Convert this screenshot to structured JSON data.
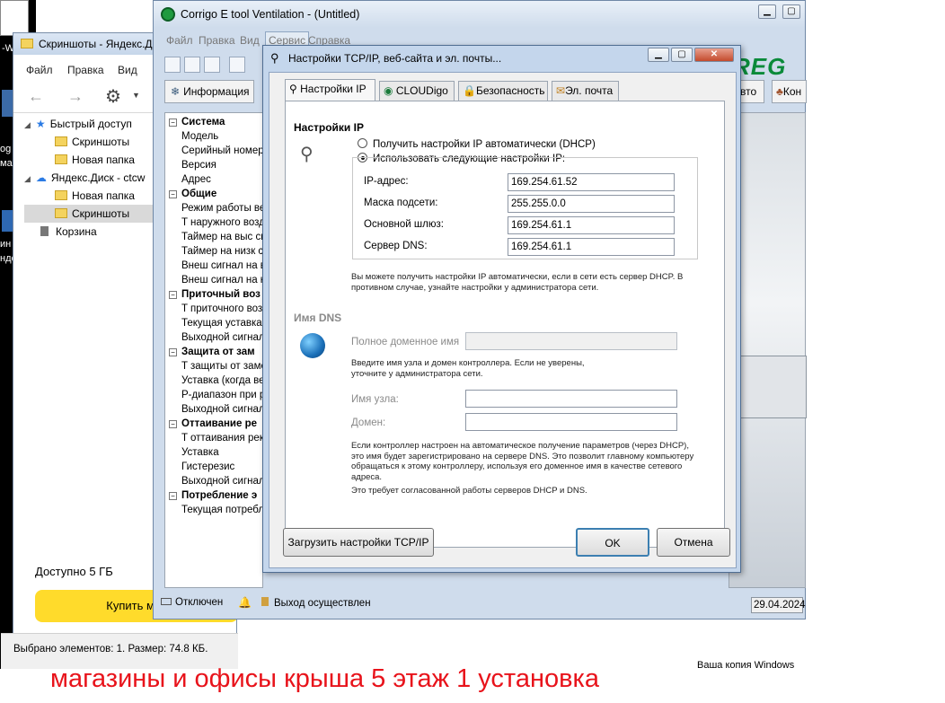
{
  "desktop": {
    "frag_top": "-W",
    "frag_1": "og",
    "frag_2": "ма",
    "frag_3": "ин",
    "frag_4": "нде"
  },
  "explorer": {
    "title": "Скриншоты - Яндекс.Ди",
    "menu": [
      "Файл",
      "Правка",
      "Вид"
    ],
    "tree": [
      {
        "label": "Быстрый доступ",
        "icon": "star-icon"
      },
      {
        "label": "Скриншоты",
        "icon": "folder-icon"
      },
      {
        "label": "Новая папка",
        "icon": "folder-icon"
      },
      {
        "label": "Яндекс.Диск - ctcw",
        "icon": "cloud-icon"
      },
      {
        "label": "Новая папка",
        "icon": "folder-icon"
      },
      {
        "label": "Скриншоты",
        "icon": "folder-icon"
      },
      {
        "label": "Корзина",
        "icon": "trash-icon"
      }
    ],
    "available": "Доступно 5 ГБ",
    "buy_button": "Купить мес",
    "status": "Выбрано элементов: 1. Размер: 74.8 КБ."
  },
  "corrigo": {
    "title": "Corrigo E tool Ventilation - (Untitled)",
    "menu": [
      "Файл",
      "Правка",
      "Вид",
      "Сервис",
      "Справка"
    ],
    "info_tab": "Информация",
    "right_tab_1": "вто",
    "right_tab_2": "Кон",
    "logo": "REG",
    "tree": [
      {
        "label": "Система",
        "head": true
      },
      {
        "label": "Модель"
      },
      {
        "label": "Серийный номер"
      },
      {
        "label": "Версия"
      },
      {
        "label": "Адрес"
      },
      {
        "label": "Общие",
        "head": true
      },
      {
        "label": "Режим работы ве"
      },
      {
        "label": "T наружного возд"
      },
      {
        "label": "Таймер на выс сн"
      },
      {
        "label": "Таймер на низк с"
      },
      {
        "label": "Внеш сигнал на в"
      },
      {
        "label": "Внеш сигнал на н"
      },
      {
        "label": "Приточный воз",
        "head": true
      },
      {
        "label": "T приточного воз"
      },
      {
        "label": "Текущая уставка"
      },
      {
        "label": "Выходной сигнал"
      },
      {
        "label": "Защита от зам",
        "head": true
      },
      {
        "label": "T защиты от замо"
      },
      {
        "label": "Уставка (когда ве"
      },
      {
        "label": "P-диапазон при р"
      },
      {
        "label": "Выходной сигнал"
      },
      {
        "label": "Оттаивание ре",
        "head": true
      },
      {
        "label": "T оттаивания рек"
      },
      {
        "label": "Уставка"
      },
      {
        "label": "Гистерезис"
      },
      {
        "label": "Выходной сигнал"
      },
      {
        "label": "Потребление э",
        "head": true
      },
      {
        "label": "Текущая потребл"
      }
    ],
    "status": {
      "disconnected": "Отключен",
      "logout": "Выход осуществлен",
      "date": "29.04.2024"
    },
    "windows_note": "Ваша копия Windows"
  },
  "dialog": {
    "title": "Настройки TCP/IP, веб-сайта и эл. почты...",
    "tabs": [
      "Настройки IP",
      "CLOUDigo",
      "Безопасность",
      "Эл. почта"
    ],
    "ip_section_title": "Настройки IP",
    "radio_auto": "Получить настройки IP автоматически (DHCP)",
    "radio_manual": "Использовать следующие настройки IP:",
    "fields": [
      {
        "label": "IP-адрес:",
        "value": "169.254.61.52"
      },
      {
        "label": "Маска подсети:",
        "value": "255.255.0.0"
      },
      {
        "label": "Основной шлюз:",
        "value": "169.254.61.1"
      },
      {
        "label": "Сервер DNS:",
        "value": "169.254.61.1"
      }
    ],
    "ip_note": "Вы можете получить настройки IP автоматически, если в сети есть сервер DHCP. В противном случае, узнайте настройки у администратора сети.",
    "dns_section_title": "Имя DNS",
    "fqdn_label": "Полное доменное имя",
    "fqdn_value": "",
    "dns_note": "Введите имя узла и домен контроллера. Если не уверены, уточните у администратора сети.",
    "host_label": "Имя узла:",
    "host_value": "",
    "domain_label": "Домен:",
    "domain_value": "",
    "dhcp_note": "Если контроллер настроен на автоматическое получение параметров (через DHCP), это имя будет зарегистрировано на сервере DNS. Это позволит главному компьютеру обращаться к этому контроллеру, используя его доменное имя в качестве сетевого адреса.",
    "dhcp_note2": "Это требует согласованной работы серверов DHCP и DNS.",
    "load_button": "Загрузить настройки TCP/IP",
    "ok_button": "OK",
    "cancel_button": "Отмена"
  },
  "caption": "магазины и офисы крыша 5 этаж 1 установка",
  "colors": {
    "caption_red": "#e8131b",
    "buy_yellow": "#ffdb2b",
    "logo_green": "#0a8a3a"
  }
}
